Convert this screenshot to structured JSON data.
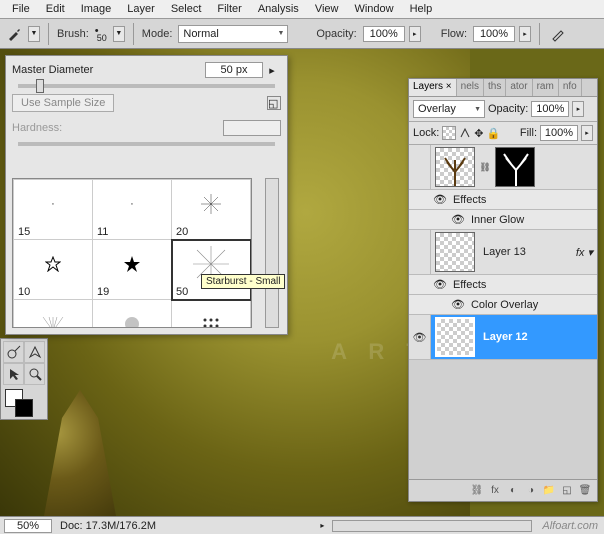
{
  "menu": [
    "File",
    "Edit",
    "Image",
    "Layer",
    "Select",
    "Filter",
    "Analysis",
    "View",
    "Window",
    "Help"
  ],
  "toolbar": {
    "brush_label": "Brush:",
    "brush_size": "50",
    "mode_label": "Mode:",
    "mode_value": "Normal",
    "opacity_label": "Opacity:",
    "opacity_value": "100%",
    "flow_label": "Flow:",
    "flow_value": "100%"
  },
  "brush_popup": {
    "master_diameter_label": "Master Diameter",
    "master_diameter_value": "50 px",
    "use_sample_btn": "Use Sample Size",
    "hardness_label": "Hardness:",
    "hardness_value": "",
    "grid": [
      [
        {
          "n": "15",
          "t": "dot"
        },
        {
          "n": "11",
          "t": "dot"
        },
        {
          "n": "20",
          "t": "burst"
        }
      ],
      [
        {
          "n": "10",
          "t": "star-outline"
        },
        {
          "n": "19",
          "t": "star-solid"
        },
        {
          "n": "50",
          "t": "starburst",
          "sel": true
        }
      ],
      [
        {
          "n": "",
          "t": "ray"
        },
        {
          "n": "",
          "t": "fuzzy"
        },
        {
          "n": "",
          "t": "halftone"
        }
      ]
    ],
    "tooltip": "Starburst - Small"
  },
  "layers_panel": {
    "tabs": [
      "Layers ×",
      "nels",
      "ths",
      "ator",
      "ram",
      "nfo"
    ],
    "blend_mode": "Overlay",
    "opacity_label": "Opacity:",
    "opacity_value": "100%",
    "lock_label": "Lock:",
    "fill_label": "Fill:",
    "fill_value": "100%",
    "layers": [
      {
        "name": "",
        "type": "tree-mask",
        "visible": false,
        "effects": [
          "Inner Glow"
        ]
      },
      {
        "name": "Layer 13",
        "type": "normal",
        "visible": false,
        "fx": true,
        "effects": [
          "Color Overlay"
        ]
      },
      {
        "name": "Layer 12",
        "type": "normal",
        "visible": true,
        "selected": true
      }
    ],
    "effects_label": "Effects"
  },
  "statusbar": {
    "zoom": "50%",
    "doc": "Doc: 17.3M/176.2M",
    "site": "Alfoart.com"
  },
  "watermark": "A R T . C"
}
